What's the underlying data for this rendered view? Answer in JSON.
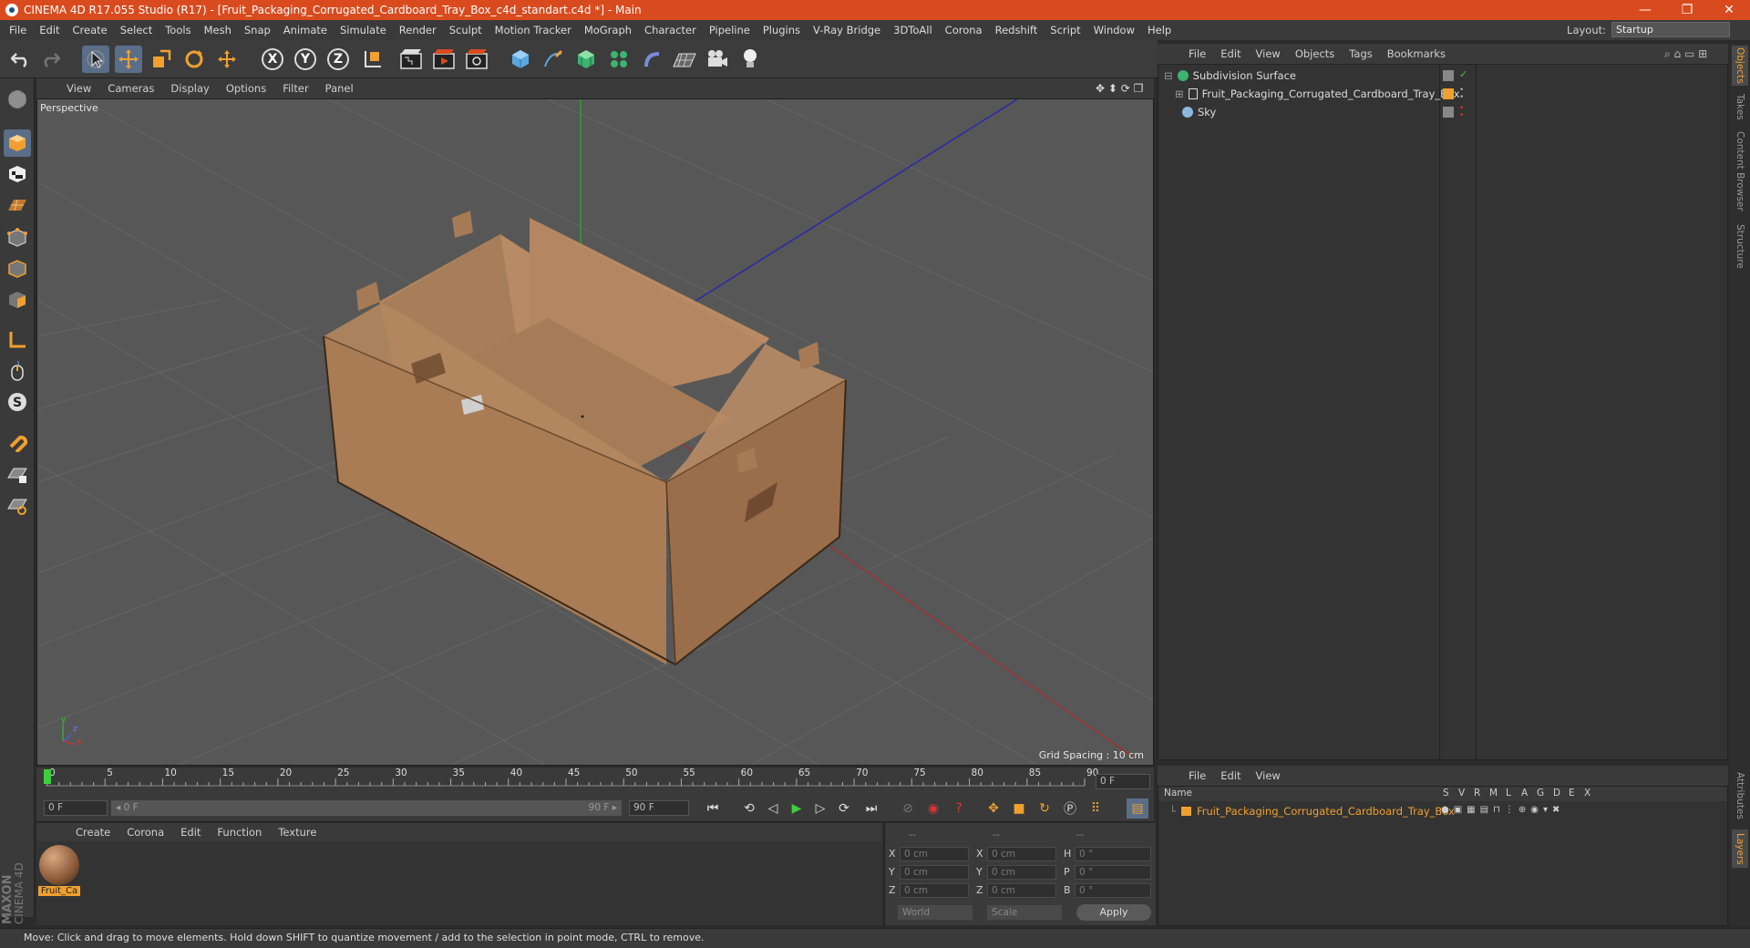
{
  "window": {
    "title": "CINEMA 4D R17.055 Studio (R17) - [Fruit_Packaging_Corrugated_Cardboard_Tray_Box_c4d_standart.c4d *] - Main",
    "minimize": "—",
    "maximize": "❐",
    "close": "✕"
  },
  "menu": [
    "File",
    "Edit",
    "Create",
    "Select",
    "Tools",
    "Mesh",
    "Snap",
    "Animate",
    "Simulate",
    "Render",
    "Sculpt",
    "Motion Tracker",
    "MoGraph",
    "Character",
    "Pipeline",
    "Plugins",
    "V-Ray Bridge",
    "3DToAll",
    "Corona",
    "Redshift",
    "Script",
    "Window",
    "Help"
  ],
  "layout": {
    "label": "Layout:",
    "value": "Startup"
  },
  "toolbar": {
    "axis_x": "X",
    "axis_y": "Y",
    "axis_z": "Z"
  },
  "viewport": {
    "menu": [
      "View",
      "Cameras",
      "Display",
      "Options",
      "Filter",
      "Panel"
    ],
    "label": "Perspective",
    "grid_spacing": "Grid Spacing : 10 cm",
    "gizmo_y": "y",
    "gizmo_z": "z",
    "gizmo_x": "x"
  },
  "timeline": {
    "ticks": [
      "0",
      "5",
      "10",
      "15",
      "20",
      "25",
      "30",
      "35",
      "40",
      "45",
      "50",
      "55",
      "60",
      "65",
      "70",
      "75",
      "80",
      "85",
      "90"
    ],
    "current_frame": "0 F"
  },
  "transport": {
    "start_field": "0 F",
    "range_start": "◂ 0 F",
    "range_end": "90 F ▸",
    "end_field": "90 F"
  },
  "materials": {
    "menu": [
      "Create",
      "Corona",
      "Edit",
      "Function",
      "Texture"
    ],
    "items": [
      {
        "name": "Fruit_Ca"
      }
    ]
  },
  "brand": {
    "line1": "MAXON",
    "line2": "CINEMA 4D"
  },
  "coords": {
    "header": [
      "--",
      "--",
      "--"
    ],
    "rows": [
      {
        "l1": "X",
        "v1": "0 cm",
        "l2": "X",
        "v2": "0 cm",
        "l3": "H",
        "v3": "0 °"
      },
      {
        "l1": "Y",
        "v1": "0 cm",
        "l2": "Y",
        "v2": "0 cm",
        "l3": "P",
        "v3": "0 °"
      },
      {
        "l1": "Z",
        "v1": "0 cm",
        "l2": "Z",
        "v2": "0 cm",
        "l3": "B",
        "v3": "0 °"
      }
    ],
    "space": "World",
    "mode": "Scale",
    "apply": "Apply"
  },
  "status": "Move: Click and drag to move elements. Hold down SHIFT to quantize movement / add to the selection in point mode, CTRL to remove.",
  "objects": {
    "menu": [
      "File",
      "Edit",
      "View",
      "Objects",
      "Tags",
      "Bookmarks"
    ],
    "items": [
      {
        "name": "Subdivision Surface"
      },
      {
        "name": "Fruit_Packaging_Corrugated_Cardboard_Tray_Box"
      },
      {
        "name": "Sky"
      }
    ]
  },
  "layers": {
    "menu": [
      "File",
      "Edit",
      "View"
    ],
    "columns": {
      "name": "Name",
      "flags": [
        "S",
        "V",
        "R",
        "M",
        "L",
        "A",
        "G",
        "D",
        "E",
        "X"
      ]
    },
    "items": [
      {
        "name": "Fruit_Packaging_Corrugated_Cardboard_Tray_Box"
      }
    ]
  },
  "side_tabs": [
    "Objects",
    "Takes",
    "Content Browser",
    "Structure",
    "Attributes",
    "Layers"
  ],
  "colors": {
    "accent": "#d94b1e",
    "box": "#a87a55",
    "highlight": "#f0a030"
  }
}
